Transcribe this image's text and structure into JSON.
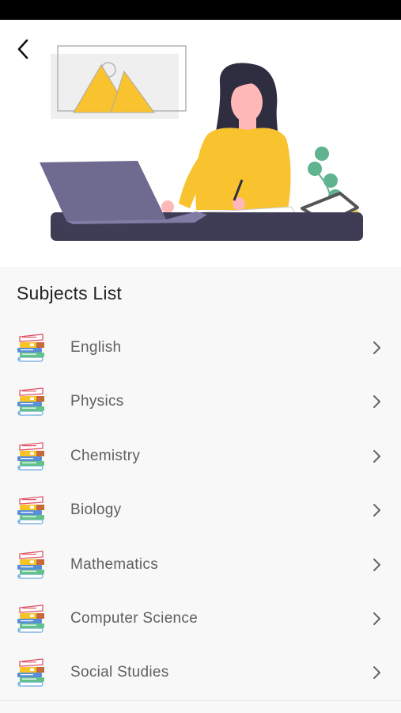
{
  "colors": {
    "accent": "#f9c22f",
    "laptop": "#6f6a8f",
    "desk": "#3f3d56",
    "hair": "#2f2e41",
    "skin": "#ffb8b8",
    "plant": "#5fb38e"
  },
  "header": {
    "back_icon": "chevron-left-icon"
  },
  "section": {
    "title": "Subjects List"
  },
  "subjects": [
    {
      "label": "English",
      "icon": "books-stack-icon"
    },
    {
      "label": "Physics",
      "icon": "books-stack-icon"
    },
    {
      "label": "Chemistry",
      "icon": "books-stack-icon"
    },
    {
      "label": "Biology",
      "icon": "books-stack-icon"
    },
    {
      "label": "Mathematics",
      "icon": "books-stack-icon"
    },
    {
      "label": "Computer Science",
      "icon": "books-stack-icon"
    },
    {
      "label": "Social Studies",
      "icon": "books-stack-icon"
    }
  ]
}
